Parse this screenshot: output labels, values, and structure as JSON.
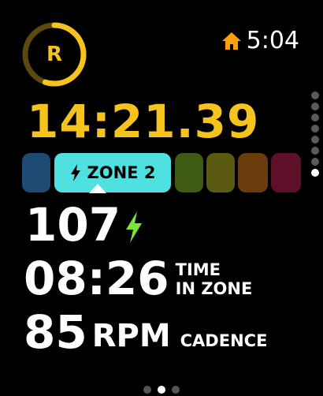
{
  "status": {
    "time": "5:04",
    "home_icon": "home-icon",
    "home_color": "#ff9f0a"
  },
  "ring": {
    "letter": "R",
    "color": "#f5c31c",
    "track_color": "#5a4a10",
    "progress": 0.55
  },
  "elapsed": {
    "value": "14:21.39",
    "color": "#f5c31c"
  },
  "zones": {
    "active_label": "ZONE 2",
    "active_icon": "bolt-icon",
    "active_color": "#4fe0e0",
    "blocks": [
      {
        "id": "zone-1",
        "color": "#1e4a73"
      },
      {
        "id": "zone-2",
        "color": "#4fe0e0"
      },
      {
        "id": "zone-3",
        "color": "#3f5a12"
      },
      {
        "id": "zone-4",
        "color": "#5a5a10"
      },
      {
        "id": "zone-5",
        "color": "#6b3b0c"
      },
      {
        "id": "zone-6",
        "color": "#5e1028"
      }
    ]
  },
  "heart_rate": {
    "value": "107",
    "icon": "bolt-icon",
    "icon_color": "#7be33a"
  },
  "time_in_zone": {
    "value": "08:26",
    "label_line1": "TIME",
    "label_line2": "IN ZONE"
  },
  "cadence": {
    "value": "85",
    "unit": "RPM",
    "label": "CADENCE"
  },
  "pager_vertical": {
    "count": 8,
    "active": 7
  },
  "pager_horizontal": {
    "count": 3,
    "active": 1
  }
}
